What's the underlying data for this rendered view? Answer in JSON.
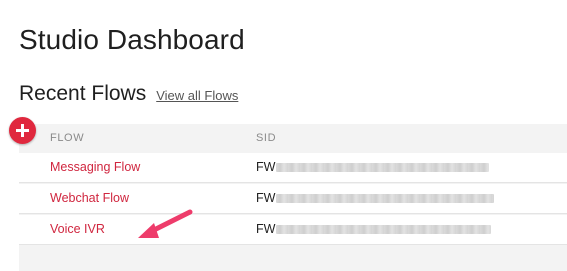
{
  "page": {
    "title": "Studio Dashboard"
  },
  "recent_flows": {
    "title": "Recent Flows",
    "view_all_label": "View all Flows",
    "columns": {
      "flow": "FLOW",
      "sid": "SID"
    },
    "rows": [
      {
        "name": "Messaging Flow",
        "sid_prefix": "FW"
      },
      {
        "name": "Webchat Flow",
        "sid_prefix": "FW"
      },
      {
        "name": "Voice IVR",
        "sid_prefix": "FW"
      }
    ]
  },
  "icons": {
    "add": "plus-circle-icon",
    "annotation": "arrow-icon"
  },
  "colors": {
    "accent": "#e0283e",
    "flow_link": "#d0263f",
    "annotation_arrow": "#ee3c6b"
  }
}
